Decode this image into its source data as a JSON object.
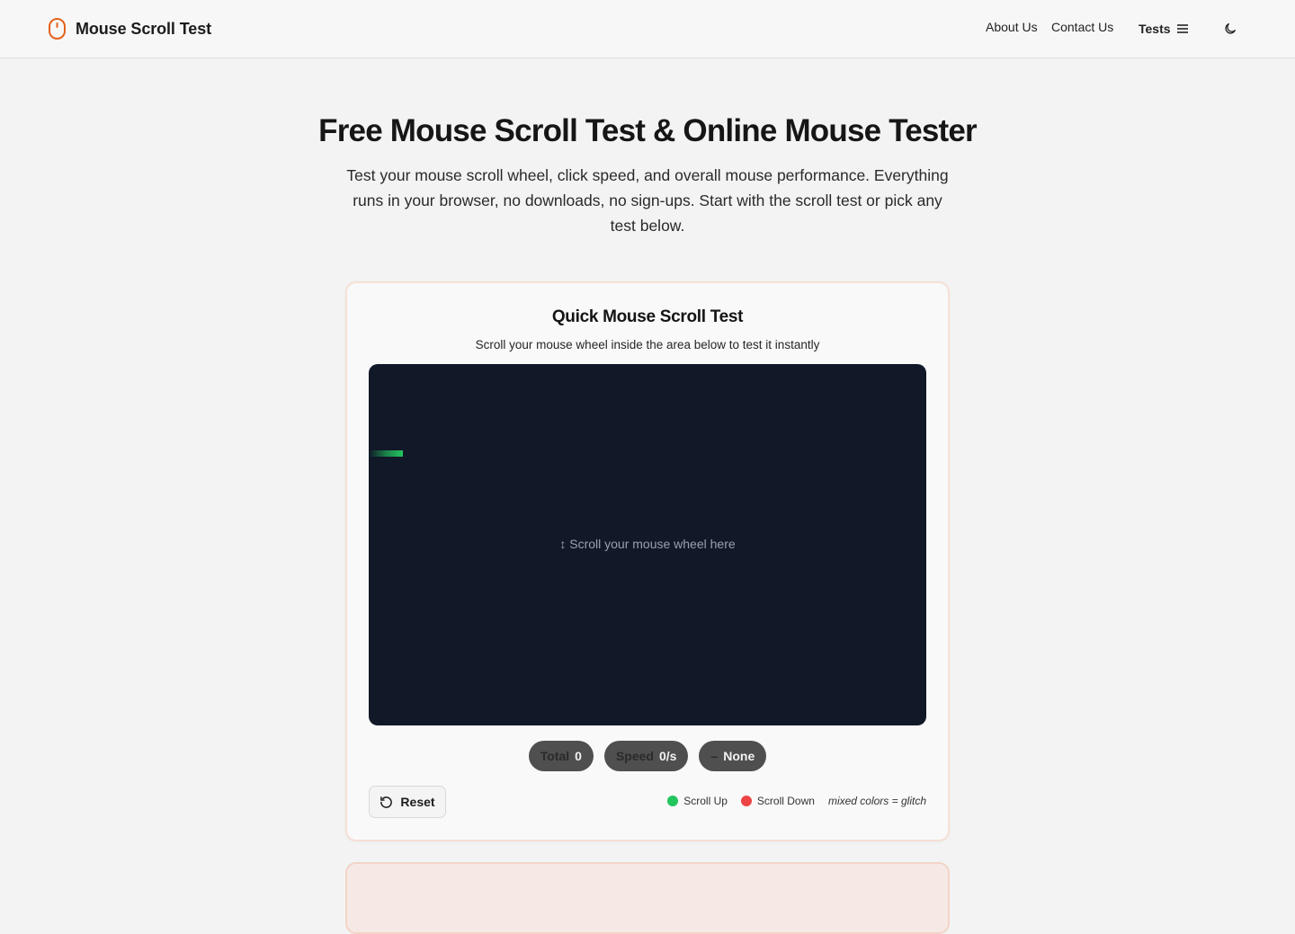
{
  "header": {
    "brand_name": "Mouse Scroll Test",
    "brand_icon": "mouse-icon",
    "brand_color": "#e4621d",
    "nav": {
      "about": "About Us",
      "contact": "Contact Us",
      "tests": "Tests"
    },
    "menu_icon": "hamburger-icon",
    "theme_icon": "moon-icon"
  },
  "hero": {
    "title": "Free Mouse Scroll Test & Online Mouse Tester",
    "subtitle": "Test your mouse scroll wheel, click speed, and overall mouse performance. Everything runs in your browser, no downloads, no sign-ups. Start with the scroll test or pick any test below."
  },
  "quick_test": {
    "title": "Quick Mouse Scroll Test",
    "subtitle": "Scroll your mouse wheel inside the area below to test it instantly",
    "scroll_hint": "↕ Scroll your mouse wheel here",
    "area_color": "#111828",
    "stats": {
      "total_label": "Total",
      "total_value": "0",
      "speed_label": "Speed",
      "speed_value": "0/s",
      "direction_symbol": "–",
      "direction_value": "None"
    },
    "reset_label": "Reset",
    "legend": {
      "up_label": "Scroll Up",
      "up_color": "#22c55e",
      "down_label": "Scroll Down",
      "down_color": "#ef4444",
      "note": "mixed colors = glitch"
    }
  }
}
